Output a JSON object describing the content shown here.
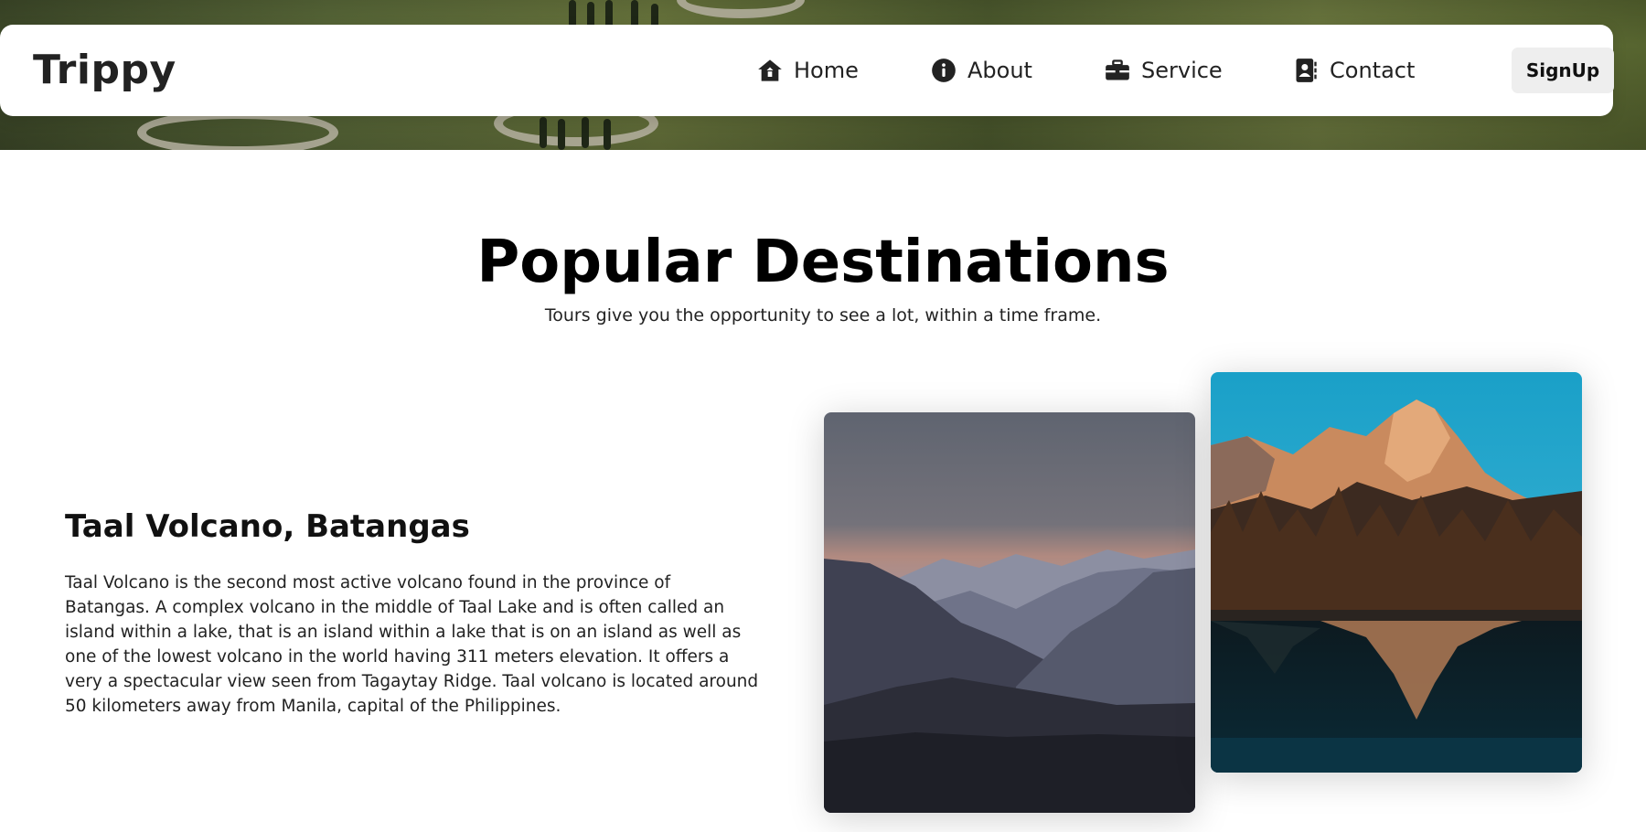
{
  "brand": "Trippy",
  "nav": {
    "items": [
      {
        "label": "Home",
        "icon": "home-icon"
      },
      {
        "label": "About",
        "icon": "info-icon"
      },
      {
        "label": "Service",
        "icon": "briefcase-icon"
      },
      {
        "label": "Contact",
        "icon": "contact-book-icon"
      }
    ],
    "signup_label": "SignUp"
  },
  "section": {
    "title": "Popular Destinations",
    "subtitle": "Tours give you the opportunity to see a lot, within a time frame."
  },
  "destination": {
    "title": "Taal Volcano, Batangas",
    "description": "Taal Volcano is the second most active volcano found in the province of Batangas. A complex volcano in the middle of Taal Lake and is often called an island within a lake, that is an island within a lake that is on an island as well as one of the lowest volcano in the world having 311 meters elevation. It offers a very a spectacular view seen from Tagaytay Ridge. Taal volcano is located around 50 kilometers away from Manila, capital of the Philippines."
  },
  "colors": {
    "navbar_bg": "#ffffff",
    "signup_bg": "#eeeeee",
    "text": "#111111"
  }
}
